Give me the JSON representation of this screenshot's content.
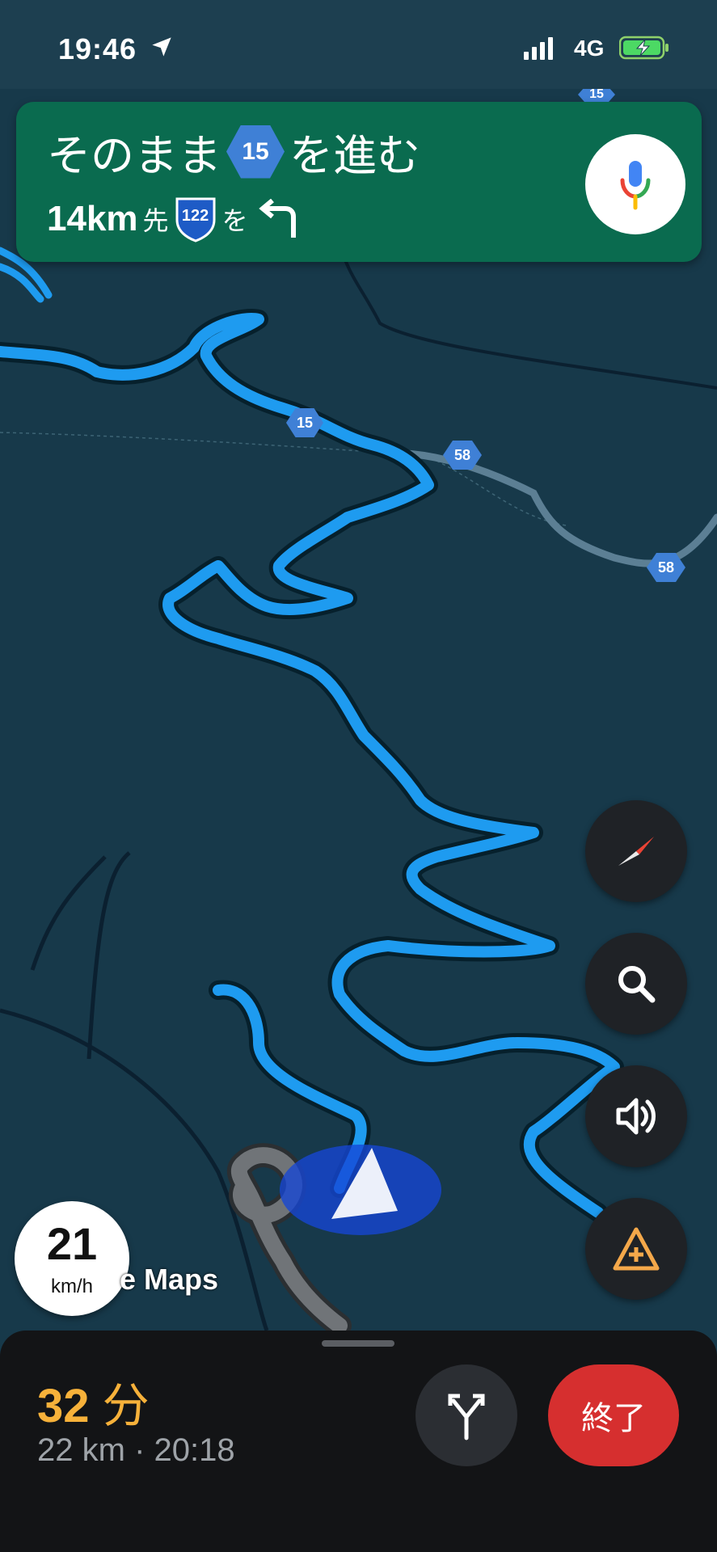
{
  "status_bar": {
    "time": "19:46",
    "network": "4G"
  },
  "navigation": {
    "instruction_prefix": "そのまま",
    "route_number": "15",
    "instruction_suffix": "を進む",
    "next_distance": "14km",
    "next_distance_suffix": "先",
    "next_route": "122",
    "next_route_suffix": "を",
    "next_turn_icon": "turn-left-arrow-icon"
  },
  "map": {
    "route_labels": [
      "15",
      "15",
      "58",
      "58"
    ],
    "watermark": "e Maps"
  },
  "speed": {
    "value": "21",
    "unit": "km/h"
  },
  "controls": [
    "compass-icon",
    "search-icon",
    "volume-icon",
    "report-incident-icon"
  ],
  "trip": {
    "minutes": "32",
    "minutes_unit": "分",
    "distance": "22 km",
    "separator": "·",
    "arrival": "20:18",
    "end_label": "終了"
  },
  "colors": {
    "nav_card": "#0a6b4f",
    "route": "#1e9bf0",
    "eta": "#f6b13a",
    "end_button": "#d62f2f",
    "map_bg": "#17394a"
  }
}
